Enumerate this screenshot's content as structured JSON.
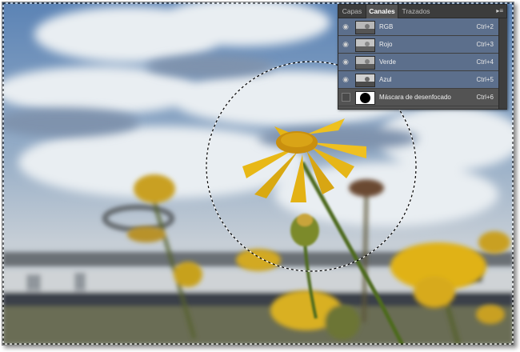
{
  "panel": {
    "tabs": [
      {
        "label": "Capas",
        "active": false
      },
      {
        "label": "Canales",
        "active": true
      },
      {
        "label": "Trazados",
        "active": false
      }
    ],
    "menu_icon": "panel-menu-icon",
    "channels": [
      {
        "name": "RGB",
        "shortcut": "Ctrl+2",
        "visible": true,
        "thumbnail": "grayscale-photo"
      },
      {
        "name": "Rojo",
        "shortcut": "Ctrl+3",
        "visible": true,
        "thumbnail": "grayscale-photo"
      },
      {
        "name": "Verde",
        "shortcut": "Ctrl+4",
        "visible": true,
        "thumbnail": "grayscale-photo"
      },
      {
        "name": "Azul",
        "shortcut": "Ctrl+5",
        "visible": true,
        "thumbnail": "grayscale-photo"
      },
      {
        "name": "Máscara de desenfocado",
        "shortcut": "Ctrl+6",
        "visible": false,
        "thumbnail": "black-circle-mask"
      }
    ]
  },
  "selection": {
    "shape": "circle",
    "style": "marching-ants"
  },
  "colors": {
    "panel_bg": "#535353",
    "selected_row": "#5c6f8c",
    "tab_bar": "#3c3c3c",
    "sky": "#6f8fb4",
    "petal": "#e2b51a"
  }
}
